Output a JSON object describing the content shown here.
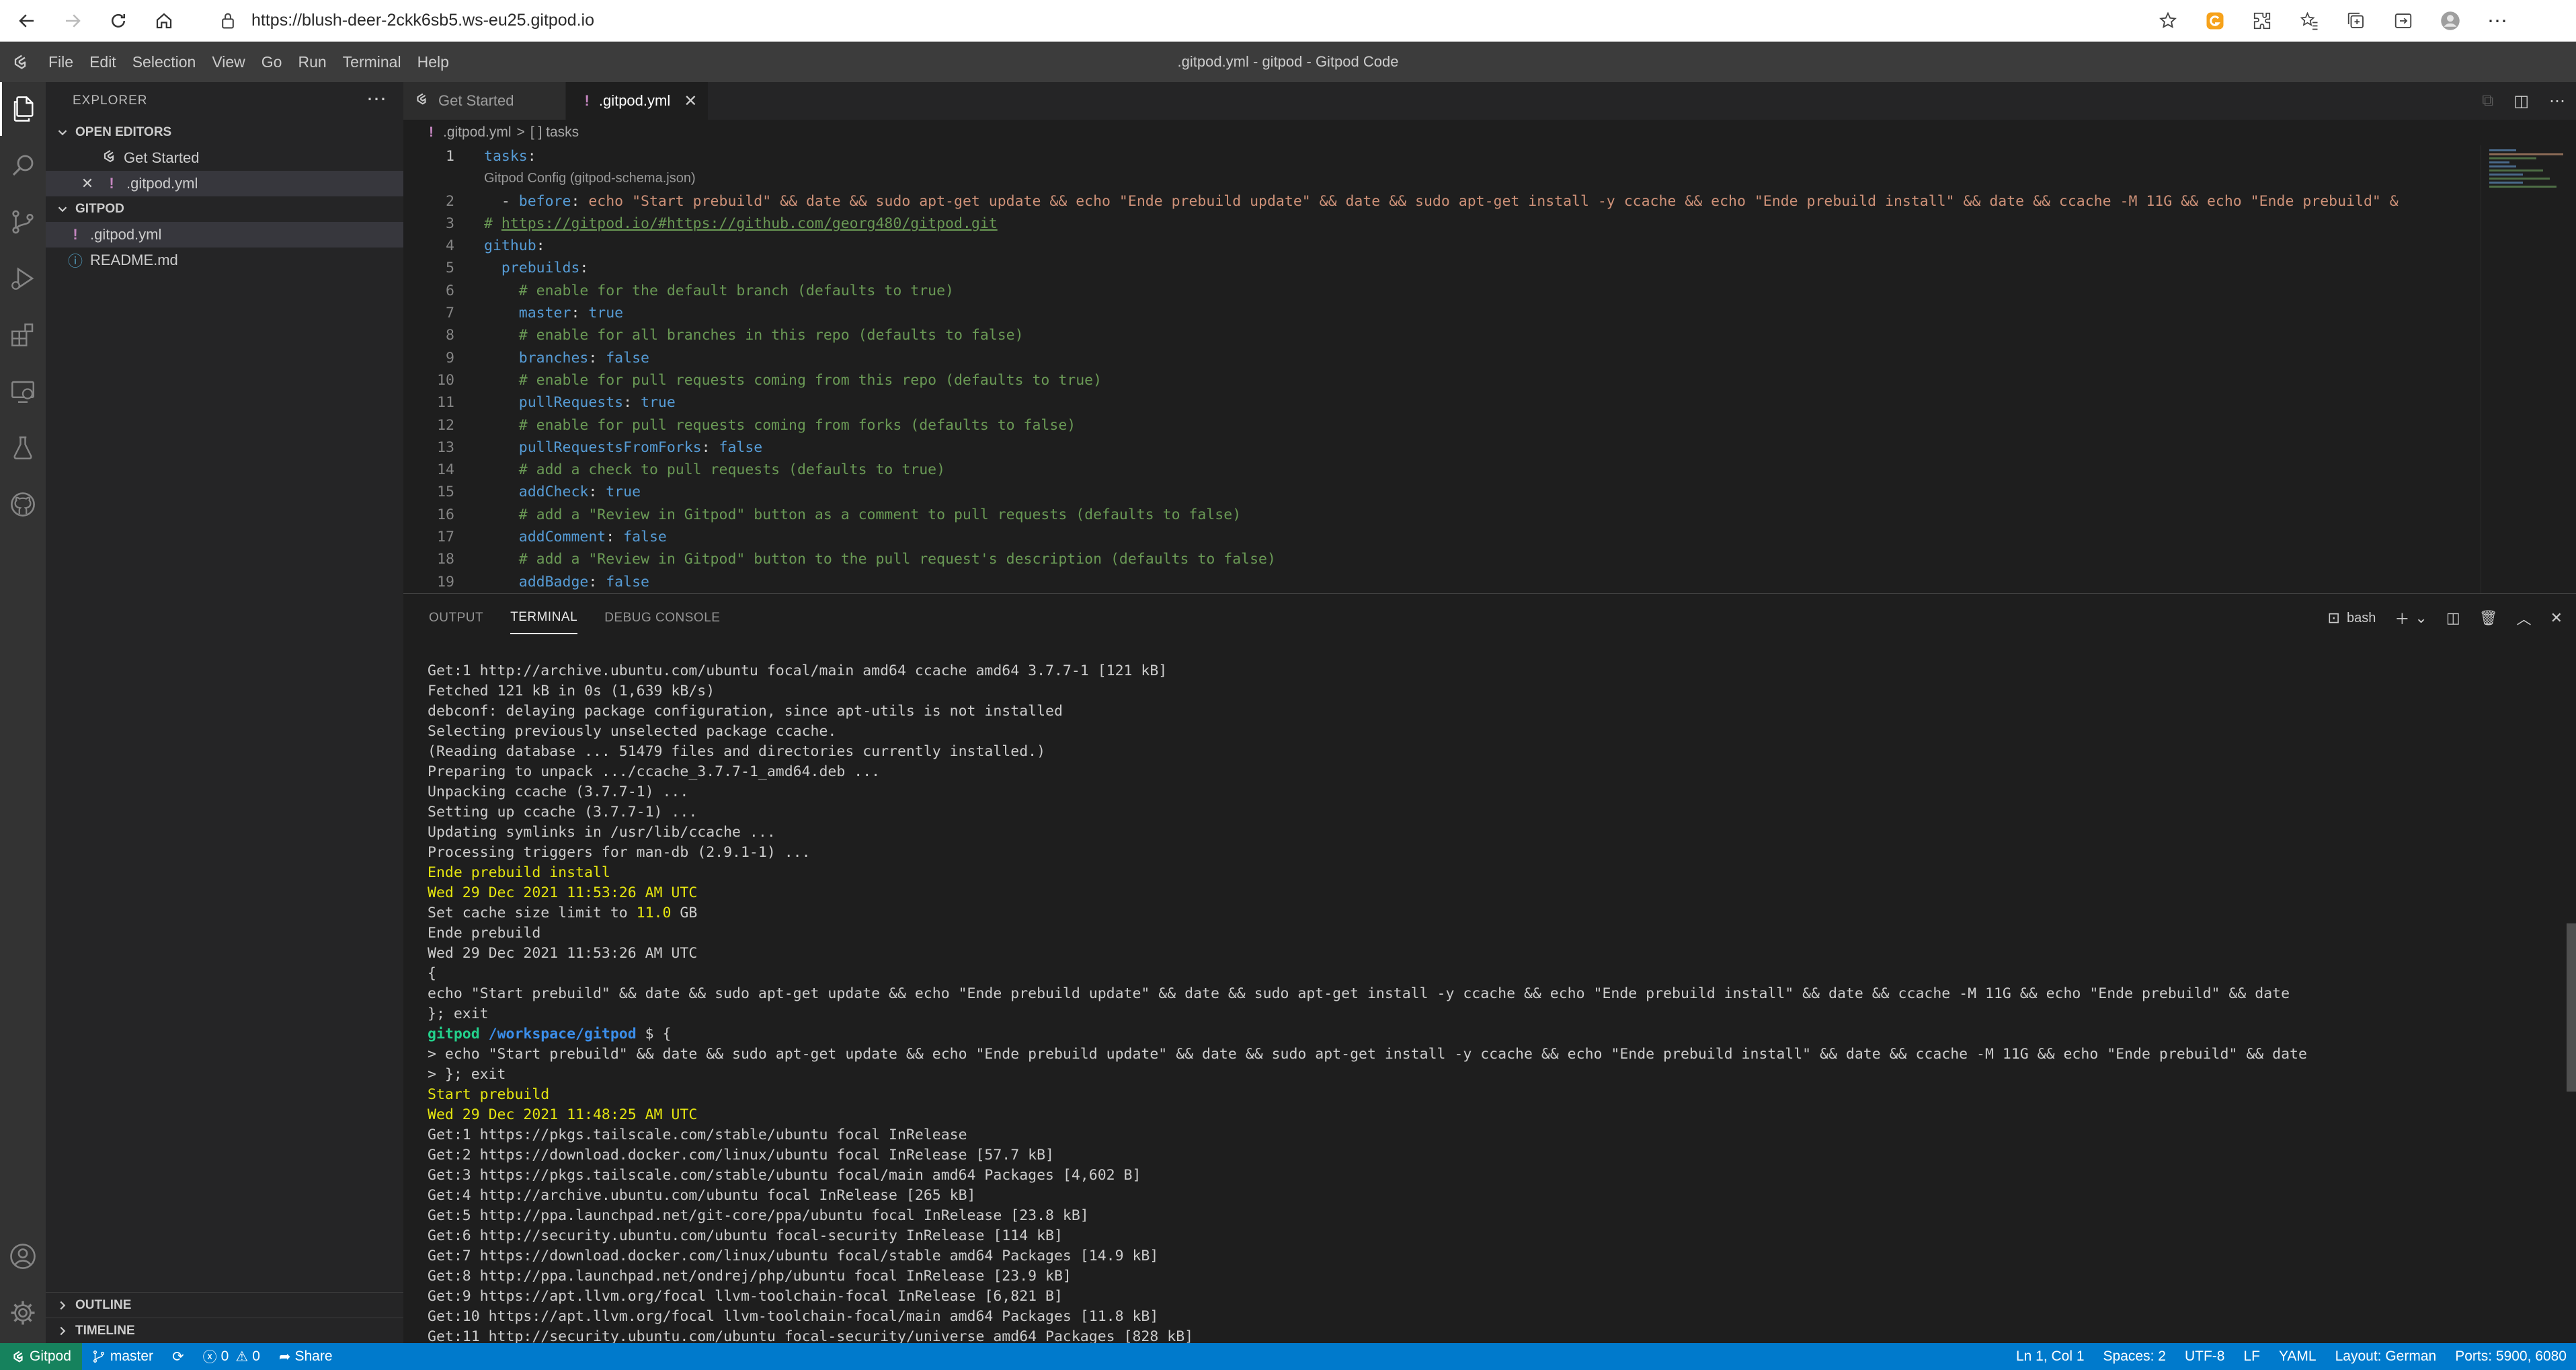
{
  "browser": {
    "url": "https://blush-deer-2ckk6sb5.ws-eu25.gitpod.io"
  },
  "window": {
    "title": ".gitpod.yml - gitpod - Gitpod Code",
    "menu": [
      "File",
      "Edit",
      "Selection",
      "View",
      "Go",
      "Run",
      "Terminal",
      "Help"
    ]
  },
  "sidebar": {
    "title": "EXPLORER",
    "open_editors_label": "OPEN EDITORS",
    "open_editors": [
      "Get Started",
      ".gitpod.yml"
    ],
    "folder_label": "GITPOD",
    "files": [
      ".gitpod.yml",
      "README.md"
    ],
    "outline_label": "OUTLINE",
    "timeline_label": "TIMELINE"
  },
  "tabs": [
    "Get Started",
    ".gitpod.yml"
  ],
  "breadcrumb": {
    "file": ".gitpod.yml",
    "separator": ">",
    "symbol": "[ ] tasks"
  },
  "editor": {
    "codelens": "Gitpod Config (gitpod-schema.json)",
    "line_numbers": [
      "1",
      "2",
      "3",
      "4",
      "5",
      "6",
      "7",
      "8",
      "9",
      "10",
      "11",
      "12",
      "13",
      "14",
      "15",
      "16",
      "17",
      "18",
      "19"
    ],
    "lines": [
      [
        [
          "k",
          "tasks"
        ],
        [
          "p",
          ":"
        ]
      ],
      [
        [
          "p",
          "  - "
        ],
        [
          "k",
          "before"
        ],
        [
          "p",
          ": "
        ],
        [
          "s",
          "echo \"Start prebuild\" && date && sudo apt-get update && echo \"Ende prebuild update\" && date && sudo apt-get install -y ccache && echo \"Ende prebuild install\" && date && ccache -M 11G && echo \"Ende prebuild\" &"
        ]
      ],
      [
        [
          "c",
          "# "
        ],
        [
          "u",
          "https://gitpod.io/#https://github.com/georg480/gitpod.git"
        ]
      ],
      [
        [
          "k",
          "github"
        ],
        [
          "p",
          ":"
        ]
      ],
      [
        [
          "p",
          "  "
        ],
        [
          "k",
          "prebuilds"
        ],
        [
          "p",
          ":"
        ]
      ],
      [
        [
          "p",
          "    "
        ],
        [
          "c",
          "# enable for the default branch (defaults to true)"
        ]
      ],
      [
        [
          "p",
          "    "
        ],
        [
          "k",
          "master"
        ],
        [
          "p",
          ": "
        ],
        [
          "b",
          "true"
        ]
      ],
      [
        [
          "p",
          "    "
        ],
        [
          "c",
          "# enable for all branches in this repo (defaults to false)"
        ]
      ],
      [
        [
          "p",
          "    "
        ],
        [
          "k",
          "branches"
        ],
        [
          "p",
          ": "
        ],
        [
          "b",
          "false"
        ]
      ],
      [
        [
          "p",
          "    "
        ],
        [
          "c",
          "# enable for pull requests coming from this repo (defaults to true)"
        ]
      ],
      [
        [
          "p",
          "    "
        ],
        [
          "k",
          "pullRequests"
        ],
        [
          "p",
          ": "
        ],
        [
          "b",
          "true"
        ]
      ],
      [
        [
          "p",
          "    "
        ],
        [
          "c",
          "# enable for pull requests coming from forks (defaults to false)"
        ]
      ],
      [
        [
          "p",
          "    "
        ],
        [
          "k",
          "pullRequestsFromForks"
        ],
        [
          "p",
          ": "
        ],
        [
          "b",
          "false"
        ]
      ],
      [
        [
          "p",
          "    "
        ],
        [
          "c",
          "# add a check to pull requests (defaults to true)"
        ]
      ],
      [
        [
          "p",
          "    "
        ],
        [
          "k",
          "addCheck"
        ],
        [
          "p",
          ": "
        ],
        [
          "b",
          "true"
        ]
      ],
      [
        [
          "p",
          "    "
        ],
        [
          "c",
          "# add a \"Review in Gitpod\" button as a comment to pull requests (defaults to false)"
        ]
      ],
      [
        [
          "p",
          "    "
        ],
        [
          "k",
          "addComment"
        ],
        [
          "p",
          ": "
        ],
        [
          "b",
          "false"
        ]
      ],
      [
        [
          "p",
          "    "
        ],
        [
          "c",
          "# add a \"Review in Gitpod\" button to the pull request's description (defaults to false)"
        ]
      ],
      [
        [
          "p",
          "    "
        ],
        [
          "k",
          "addBadge"
        ],
        [
          "p",
          ": "
        ],
        [
          "b",
          "false"
        ]
      ]
    ]
  },
  "panel": {
    "tabs": [
      "OUTPUT",
      "TERMINAL",
      "DEBUG CONSOLE"
    ],
    "terminal_name": "bash",
    "terminal_lines": [
      [
        [
          "",
          "Get:1 http://archive.ubuntu.com/ubuntu focal/main amd64 ccache amd64 3.7.7-1 [121 kB]"
        ]
      ],
      [
        [
          "",
          "Fetched 121 kB in 0s (1,639 kB/s)"
        ]
      ],
      [
        [
          "",
          "debconf: delaying package configuration, since apt-utils is not installed"
        ]
      ],
      [
        [
          "",
          "Selecting previously unselected package ccache."
        ]
      ],
      [
        [
          "",
          "(Reading database ... 51479 files and directories currently installed.)"
        ]
      ],
      [
        [
          "",
          "Preparing to unpack .../ccache_3.7.7-1_amd64.deb ..."
        ]
      ],
      [
        [
          "",
          "Unpacking ccache (3.7.7-1) ..."
        ]
      ],
      [
        [
          "",
          "Setting up ccache (3.7.7-1) ..."
        ]
      ],
      [
        [
          "",
          "Updating symlinks in /usr/lib/ccache ..."
        ]
      ],
      [
        [
          "",
          "Processing triggers for man-db (2.9.1-1) ..."
        ]
      ],
      [
        [
          "ty",
          "Ende prebuild install"
        ]
      ],
      [
        [
          "ty",
          "Wed 29 Dec 2021 11:53:26 AM UTC"
        ]
      ],
      [
        [
          "",
          "Set cache size limit to "
        ],
        [
          "ty",
          "11.0"
        ],
        [
          "",
          " GB"
        ]
      ],
      [
        [
          "",
          "Ende prebuild"
        ]
      ],
      [
        [
          "",
          "Wed 29 Dec 2021 11:53:26 AM UTC"
        ]
      ],
      [
        [
          "",
          "{"
        ]
      ],
      [
        [
          "",
          "echo \"Start prebuild\" && date && sudo apt-get update && echo \"Ende prebuild update\" && date && sudo apt-get install -y ccache && echo \"Ende prebuild install\" && date && ccache -M 11G && echo \"Ende prebuild\" && date"
        ]
      ],
      [
        [
          "",
          "}; exit"
        ]
      ],
      [
        [
          "tg",
          "gitpod"
        ],
        [
          "",
          " "
        ],
        [
          "tb",
          "/workspace/gitpod"
        ],
        [
          "",
          " $ {"
        ]
      ],
      [
        [
          "",
          "> echo \"Start prebuild\" && date && sudo apt-get update && echo \"Ende prebuild update\" && date && sudo apt-get install -y ccache && echo \"Ende prebuild install\" && date && ccache -M 11G && echo \"Ende prebuild\" && date"
        ]
      ],
      [
        [
          "",
          "> }; exit"
        ]
      ],
      [
        [
          "ty",
          "Start prebuild"
        ]
      ],
      [
        [
          "ty",
          "Wed 29 Dec 2021 11:48:25 AM UTC"
        ]
      ],
      [
        [
          "",
          "Get:1 https://pkgs.tailscale.com/stable/ubuntu focal InRelease"
        ]
      ],
      [
        [
          "",
          "Get:2 https://download.docker.com/linux/ubuntu focal InRelease [57.7 kB]"
        ]
      ],
      [
        [
          "",
          "Get:3 https://pkgs.tailscale.com/stable/ubuntu focal/main amd64 Packages [4,602 B]"
        ]
      ],
      [
        [
          "",
          "Get:4 http://archive.ubuntu.com/ubuntu focal InRelease [265 kB]"
        ]
      ],
      [
        [
          "",
          "Get:5 http://ppa.launchpad.net/git-core/ppa/ubuntu focal InRelease [23.8 kB]"
        ]
      ],
      [
        [
          "",
          "Get:6 http://security.ubuntu.com/ubuntu focal-security InRelease [114 kB]"
        ]
      ],
      [
        [
          "",
          "Get:7 https://download.docker.com/linux/ubuntu focal/stable amd64 Packages [14.9 kB]"
        ]
      ],
      [
        [
          "",
          "Get:8 http://ppa.launchpad.net/ondrej/php/ubuntu focal InRelease [23.9 kB]"
        ]
      ],
      [
        [
          "",
          "Get:9 https://apt.llvm.org/focal llvm-toolchain-focal InRelease [6,821 B]"
        ]
      ],
      [
        [
          "",
          "Get:10 https://apt.llvm.org/focal llvm-toolchain-focal/main amd64 Packages [11.8 kB]"
        ]
      ],
      [
        [
          "",
          "Get:11 http://security.ubuntu.com/ubuntu focal-security/universe amd64 Packages [828 kB]"
        ]
      ]
    ]
  },
  "statusbar": {
    "remote": "Gitpod",
    "branch": "master",
    "problems": "0",
    "warnings": "0",
    "share": "Share",
    "position": "Ln 1, Col 1",
    "spaces": "Spaces: 2",
    "encoding": "UTF-8",
    "eol": "LF",
    "language": "YAML",
    "layout": "Layout: German",
    "ports": "Ports: 5900, 6080"
  },
  "icons": {
    "brand_accent": "#007acc",
    "remote_color": "#16825d"
  }
}
